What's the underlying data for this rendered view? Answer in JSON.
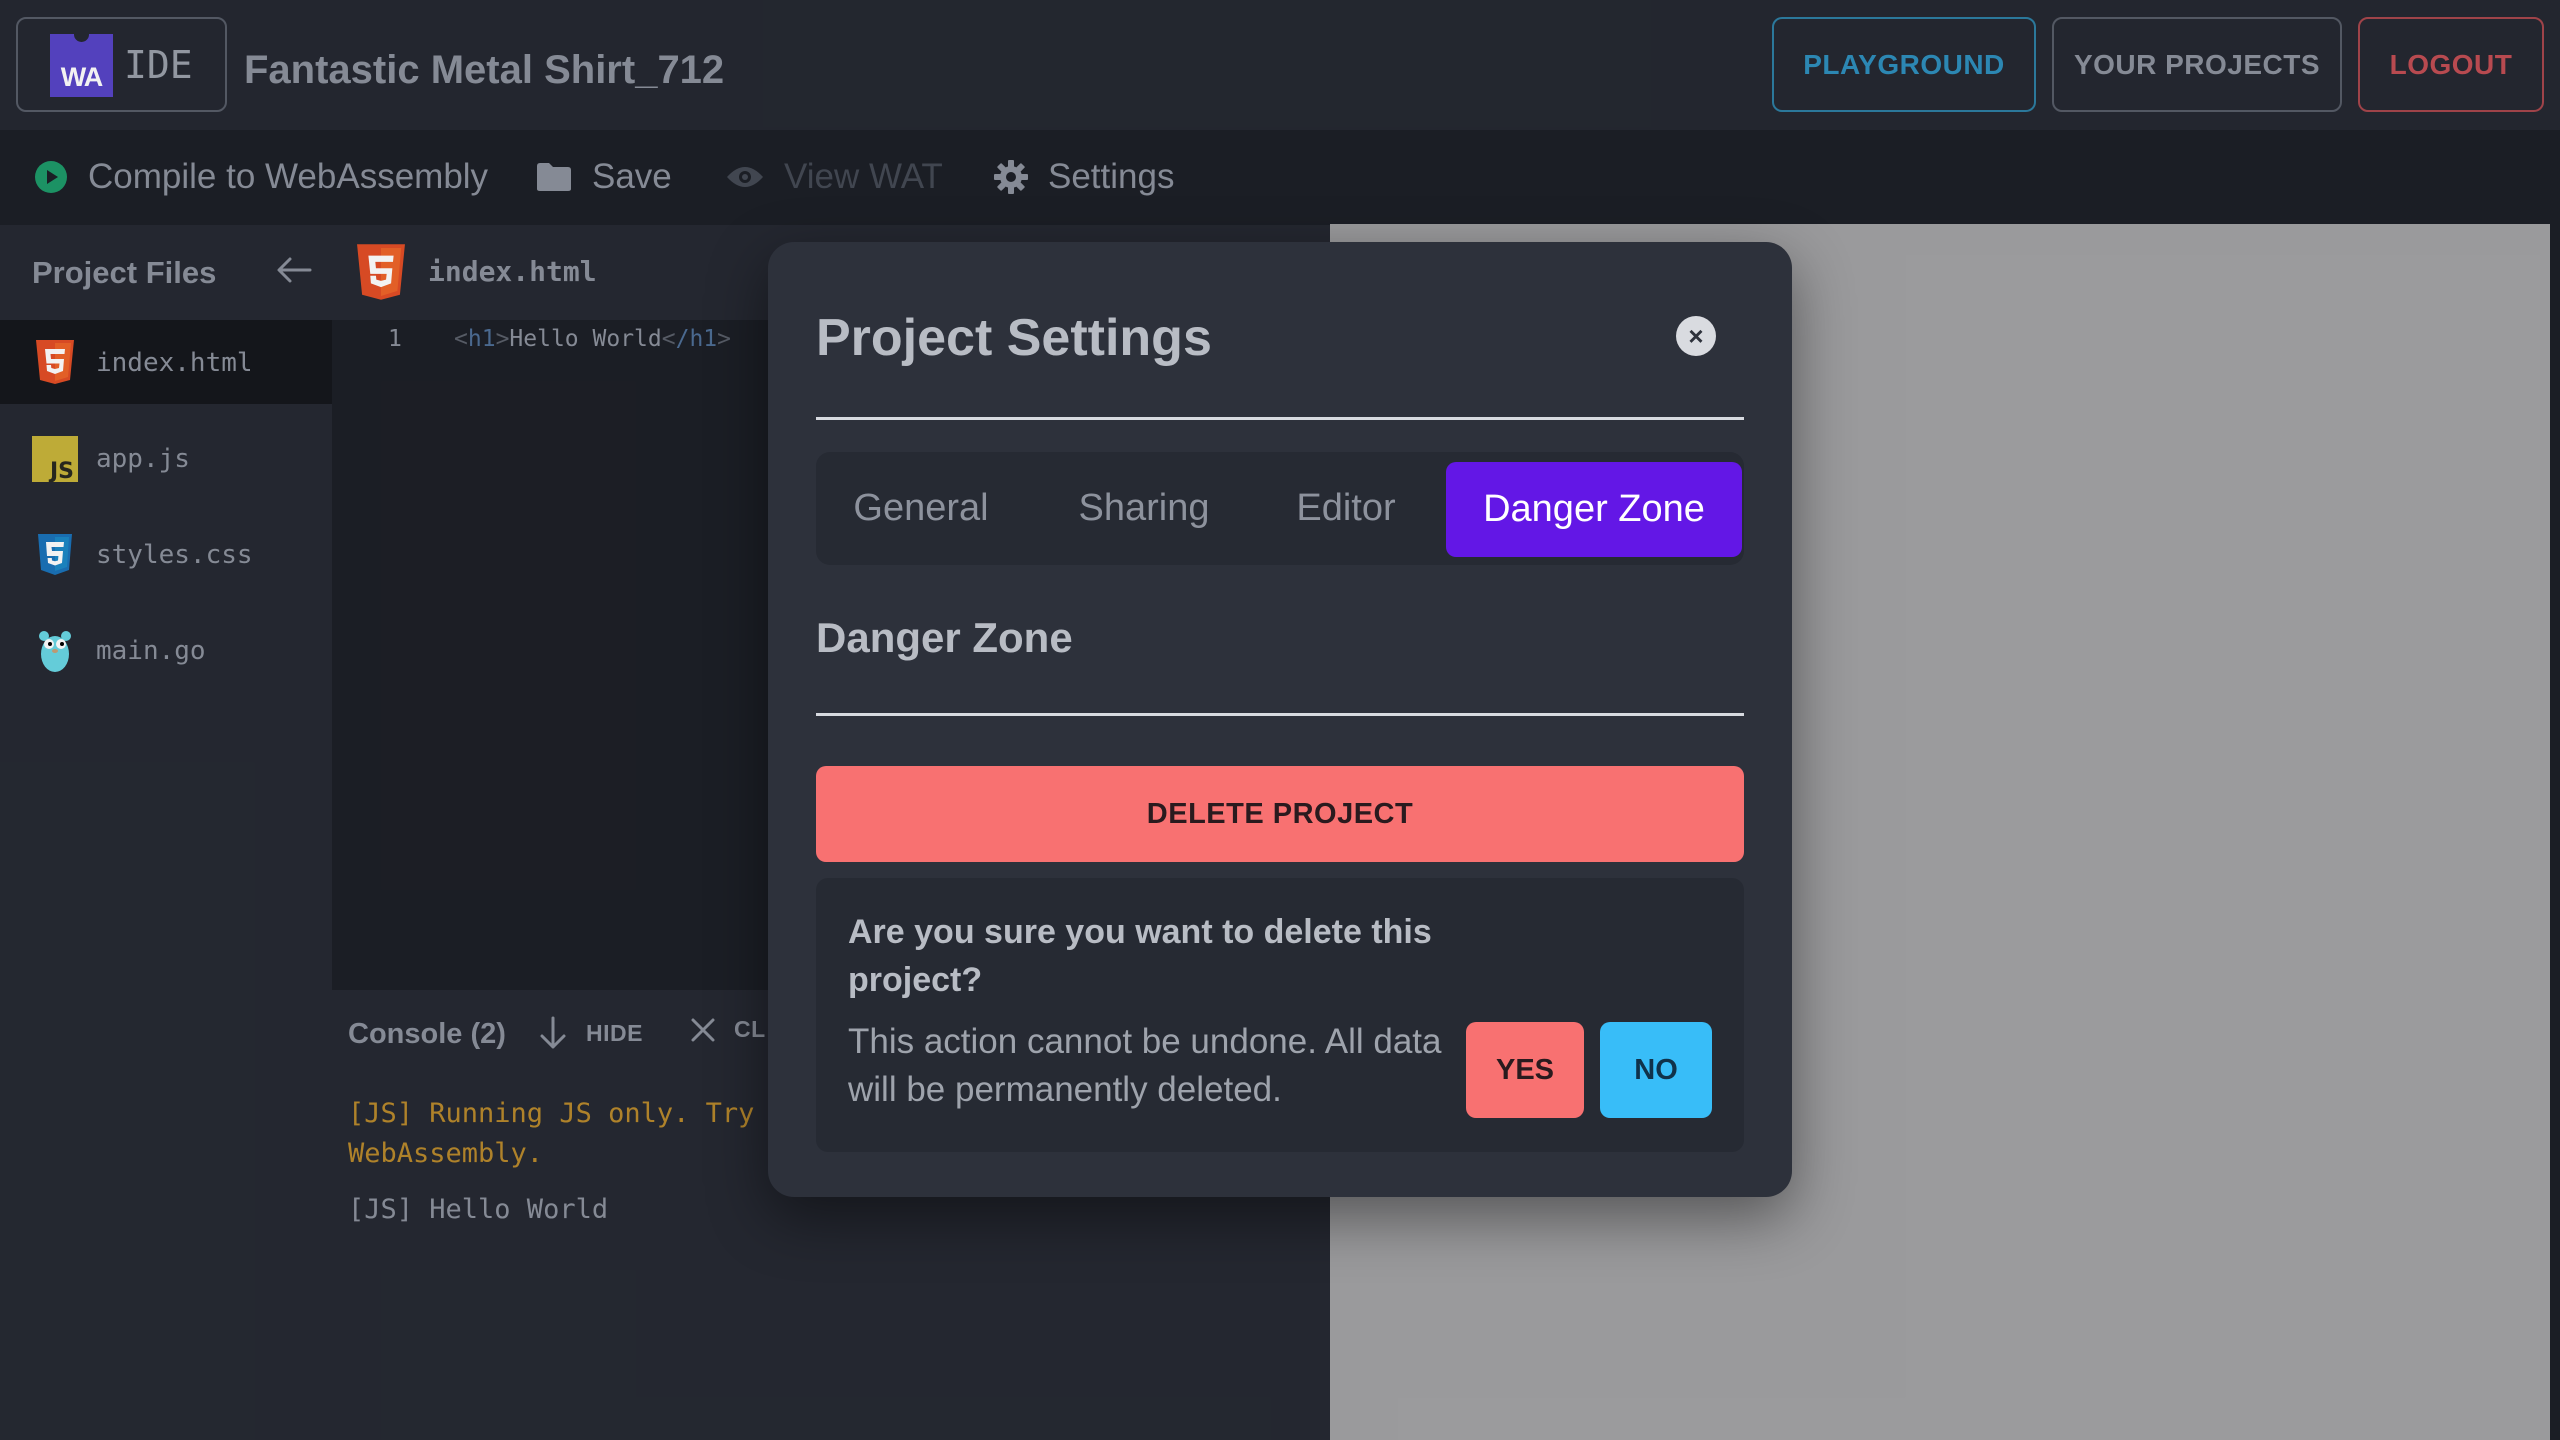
{
  "header": {
    "logo_badge": "WA",
    "logo_text": "IDE",
    "project_title": "Fantastic Metal Shirt_712",
    "buttons": {
      "playground": "PLAYGROUND",
      "your_projects": "YOUR PROJECTS",
      "logout": "LOGOUT"
    }
  },
  "toolbar": {
    "compile": "Compile to WebAssembly",
    "save": "Save",
    "view_wat": "View WAT",
    "settings": "Settings"
  },
  "sidebar": {
    "title": "Project Files",
    "files": [
      {
        "name": "index.html",
        "icon": "html5-icon",
        "active": true
      },
      {
        "name": "app.js",
        "icon": "javascript-icon",
        "active": false
      },
      {
        "name": "styles.css",
        "icon": "css3-icon",
        "active": false
      },
      {
        "name": "main.go",
        "icon": "go-gopher-icon",
        "active": false
      }
    ]
  },
  "editor": {
    "tab_name": "index.html",
    "line_number": "1",
    "code": {
      "open_tag": "h1",
      "text": "Hello World",
      "close_tag": "/h1"
    }
  },
  "console": {
    "title": "Console (2)",
    "hide_label": "HIDE",
    "clear_label": "CL",
    "logs": [
      {
        "text": "[JS] Running JS only. Try :\nWebAssembly.",
        "level": "warn"
      },
      {
        "text": "[JS] Hello World",
        "level": "info"
      }
    ]
  },
  "modal": {
    "title": "Project Settings",
    "close_symbol": "×",
    "tabs": [
      "General",
      "Sharing",
      "Editor",
      "Danger Zone"
    ],
    "active_tab": "Danger Zone",
    "section_title": "Danger Zone",
    "delete_button": "DELETE PROJECT",
    "confirm_question": "Are you sure you want to delete this project?",
    "confirm_detail": "This action cannot be undone. All data will be permanently deleted.",
    "yes": "YES",
    "no": "NO"
  },
  "colors": {
    "accent_purple": "#6317e6",
    "danger_red": "#f87171",
    "info_blue": "#38bdf8",
    "playground_blue": "#2f8fbd",
    "logout_red": "#c24e55",
    "warn_text": "#b98a2d"
  }
}
